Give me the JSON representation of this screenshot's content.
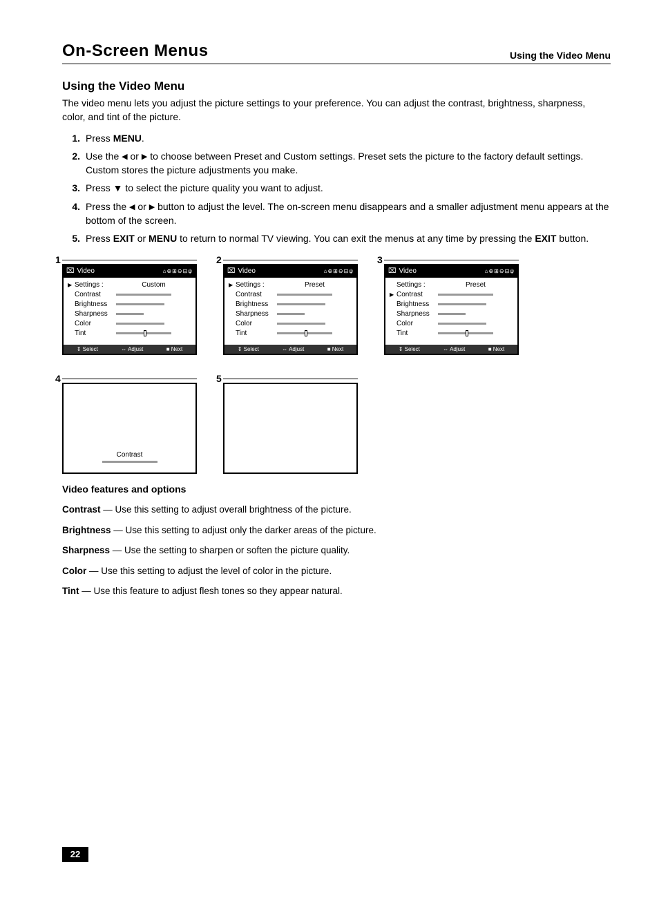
{
  "header": {
    "left": "On-Screen Menus",
    "right": "Using the Video Menu"
  },
  "subtitle": "Using the Video Menu",
  "intro": "The video menu lets you adjust the picture settings to your preference. You can adjust the contrast, brightness, sharpness, color, and tint of the picture.",
  "steps": [
    "Press <b>MENU</b>.",
    "Use the <span class='tri'>◀</span> or <span class='tri'>▶</span> to choose between Preset and Custom settings. Preset sets the picture to the factory default settings. Custom stores the picture adjustments you make.",
    "Press ▼ to select the picture quality you want to adjust.",
    "Press the <span class='tri'>◀</span> or <span class='tri'>▶</span> button to adjust the level. The on-screen menu disappears and a smaller adjustment menu appears at the bottom of the screen.",
    "Press <b>EXIT</b> or <b>MENU</b> to return to normal TV viewing. You can exit the menus at any time by pressing the <b>EXIT</b> button."
  ],
  "featureTitle": "Video features and options",
  "features": [
    {
      "name": "Contrast",
      "desc": "Use this setting to adjust overall brightness of the picture."
    },
    {
      "name": "Brightness",
      "desc": "Use this setting to adjust only the darker areas of the picture."
    },
    {
      "name": "Sharpness",
      "desc": "Use the setting to sharpen or soften the picture quality."
    },
    {
      "name": "Color",
      "desc": "Use this setting to adjust the level of color in the picture."
    },
    {
      "name": "Tint",
      "desc": "Use this feature to adjust flesh tones so they appear natural."
    }
  ],
  "osd": {
    "title": "Video",
    "iconsAlt": "menu-icons",
    "items": [
      "Settings :",
      "Contrast",
      "Brightness",
      "Sharpness",
      "Color",
      "Tint"
    ],
    "modeCustom": "Custom",
    "modePreset": "Preset",
    "footer": {
      "select": "Select",
      "adjust": "Adjust",
      "next": "Next"
    }
  },
  "fig4Label": "Contrast",
  "pageNumber": "22"
}
